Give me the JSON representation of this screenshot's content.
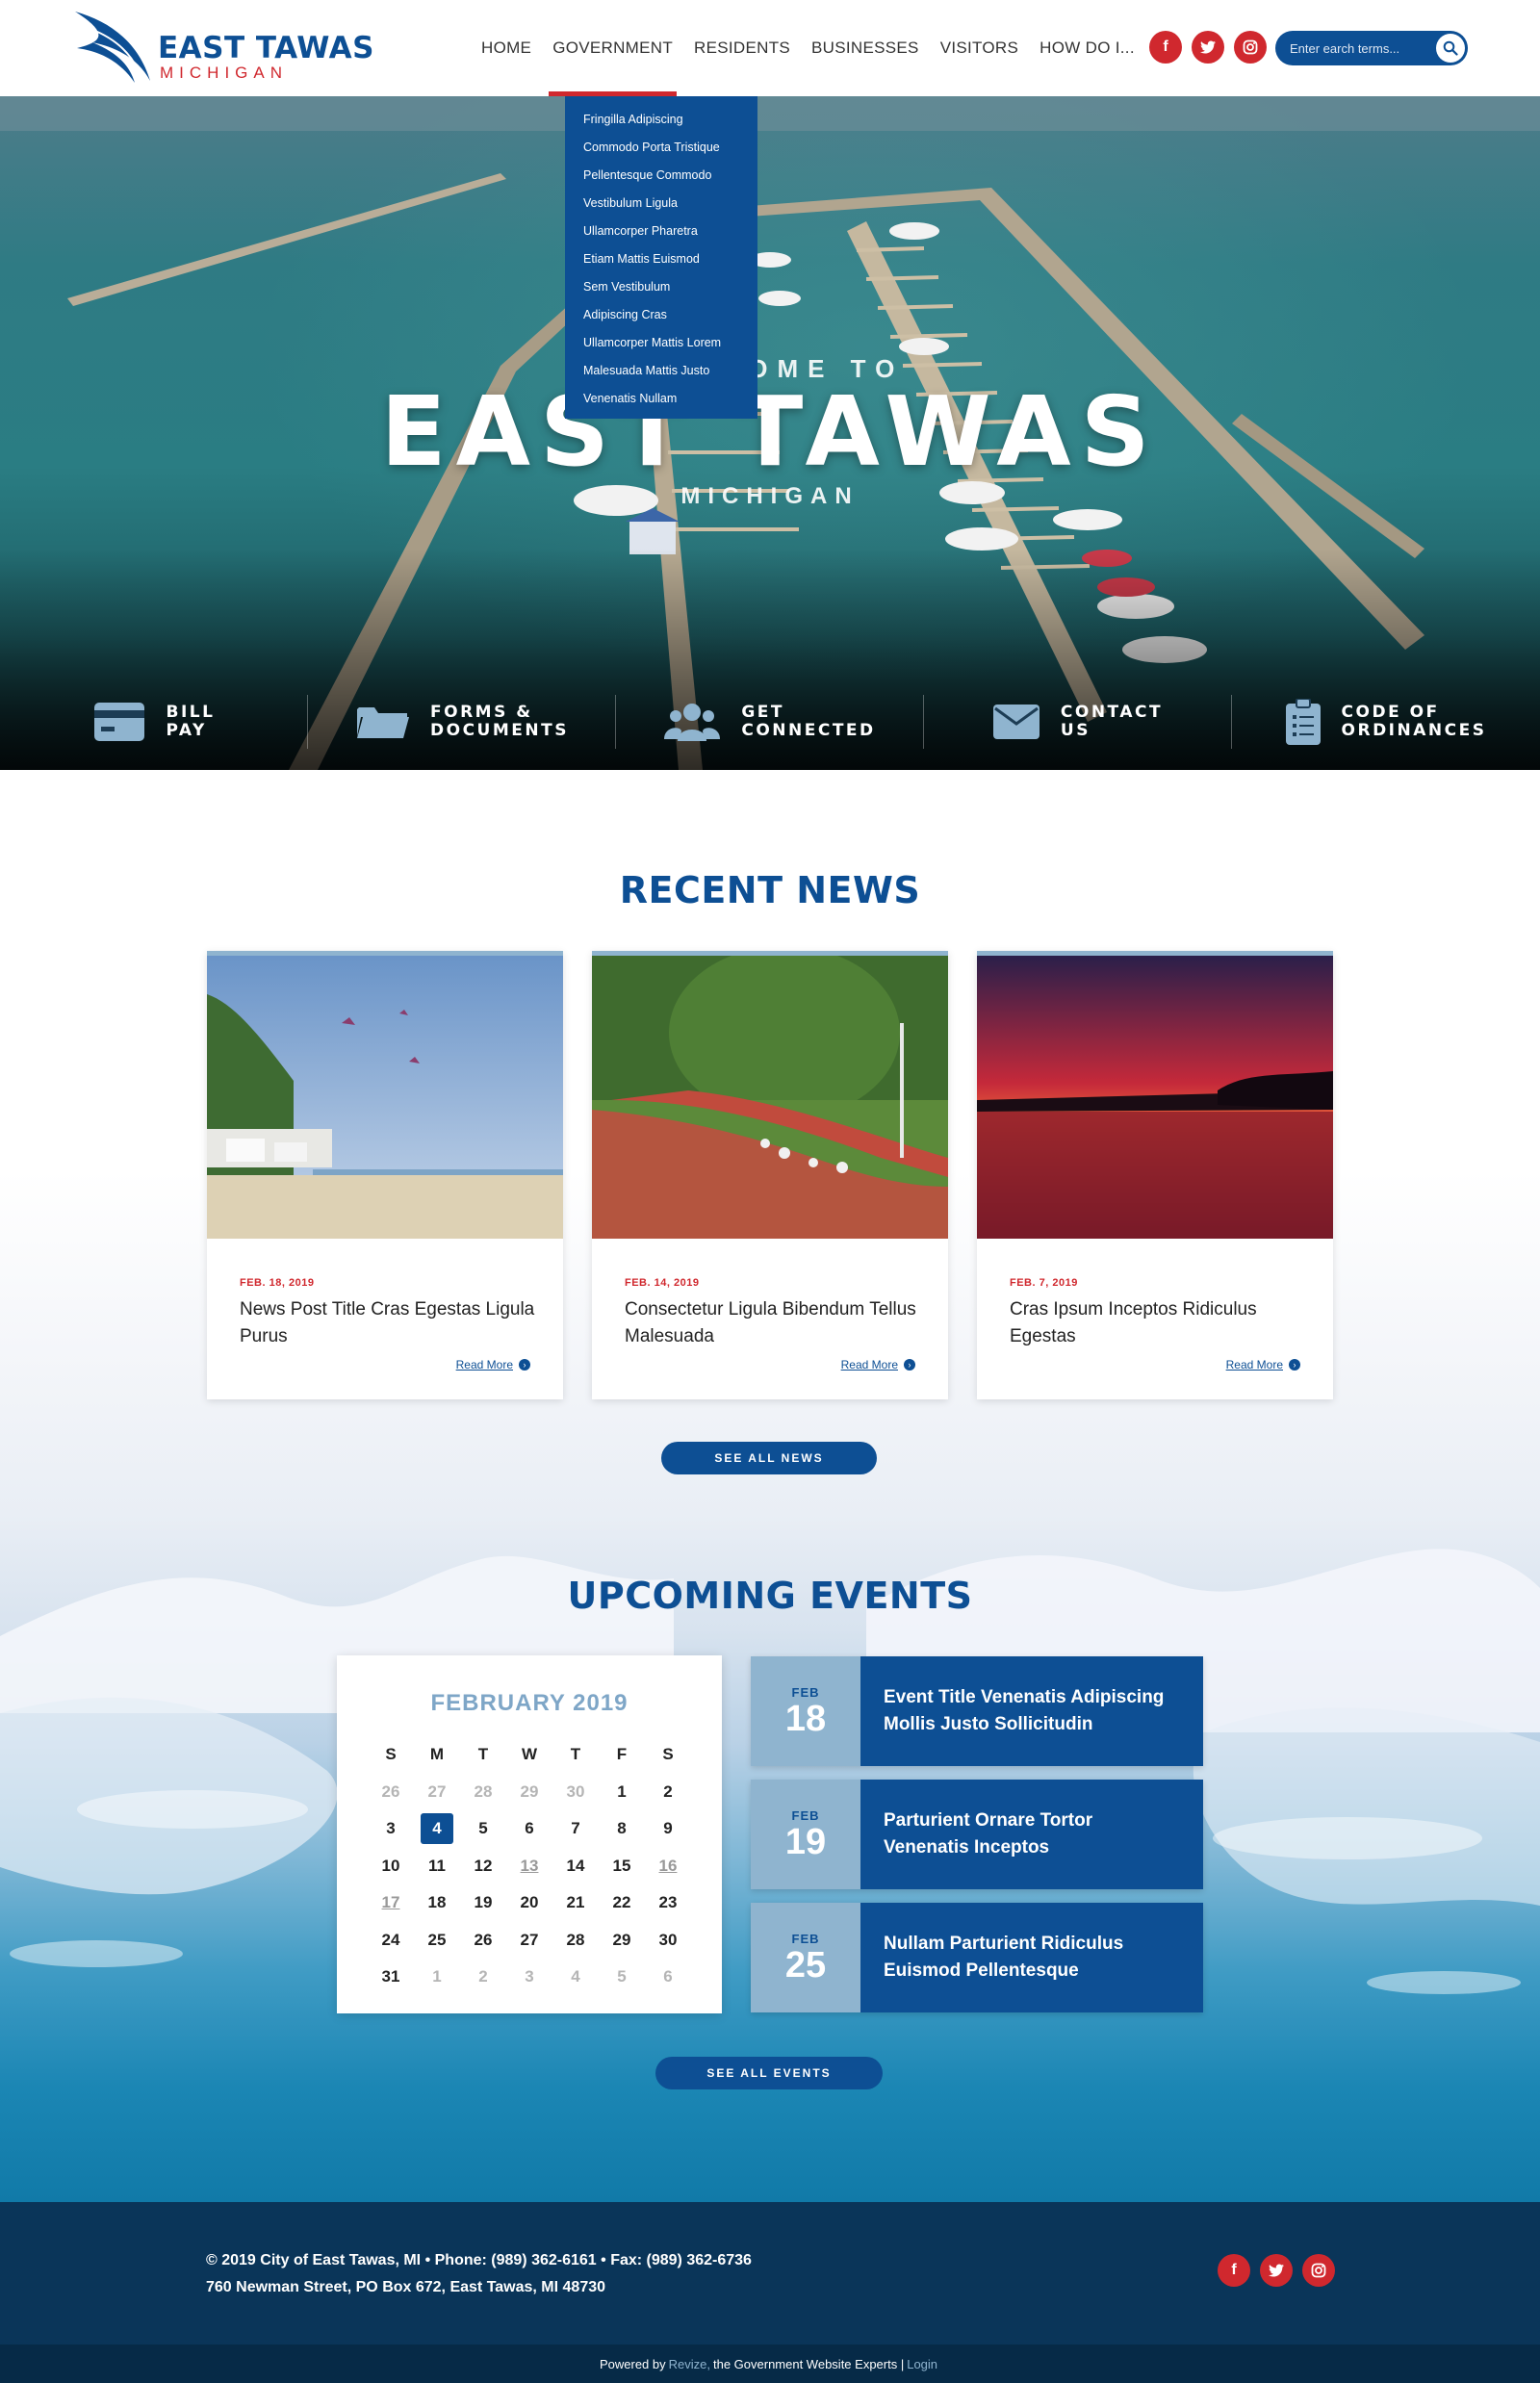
{
  "header": {
    "logo_title": "EAST TAWAS",
    "logo_subtitle": "MICHIGAN",
    "nav": [
      "HOME",
      "GOVERNMENT",
      "RESIDENTS",
      "BUSINESSES",
      "VISITORS",
      "HOW DO I..."
    ],
    "active_nav": "GOVERNMENT",
    "social": [
      "facebook-icon",
      "twitter-icon",
      "instagram-icon"
    ],
    "search_placeholder": "Enter earch terms..."
  },
  "dropdown": [
    "Fringilla Adipiscing",
    "Commodo Porta Tristique",
    "Pellentesque Commodo",
    "Vestibulum Ligula",
    "Ullamcorper Pharetra",
    "Etiam Mattis Euismod",
    "Sem Vestibulum",
    "Adipiscing Cras",
    "Ullamcorper Mattis Lorem",
    "Malesuada Mattis Justo",
    "Venenatis Nullam"
  ],
  "hero": {
    "welcome": "WELCOME TO",
    "title": "EAST TAWAS",
    "subtitle": "MICHIGAN",
    "quick_links": [
      {
        "icon": "credit-card-icon",
        "label": "BILL\nPAY"
      },
      {
        "icon": "folder-icon",
        "label": "FORMS &\nDOCUMENTS"
      },
      {
        "icon": "users-icon",
        "label": "GET\nCONNECTED"
      },
      {
        "icon": "envelope-icon",
        "label": "CONTACT\nUS"
      },
      {
        "icon": "clipboard-icon",
        "label": "CODE OF\nORDINANCES"
      }
    ]
  },
  "news": {
    "title": "RECENT NEWS",
    "read_more": "Read More",
    "items": [
      {
        "date": "FEB. 18, 2019",
        "title": "News Post Title Cras Egestas Ligula Purus"
      },
      {
        "date": "FEB. 14, 2019",
        "title": "Consectetur Ligula Bibendum Tellus Malesuada"
      },
      {
        "date": "FEB. 7, 2019",
        "title": "Cras Ipsum Inceptos Ridiculus Egestas"
      }
    ],
    "see_all": "SEE ALL NEWS"
  },
  "events": {
    "title": "UPCOMING EVENTS",
    "calendar": {
      "month": "FEBRUARY 2019",
      "weekdays": [
        "S",
        "M",
        "T",
        "W",
        "T",
        "F",
        "S"
      ],
      "days": [
        [
          "26",
          "27",
          "28",
          "29",
          "30",
          "1",
          "2"
        ],
        [
          "3",
          "4",
          "5",
          "6",
          "7",
          "8",
          "9"
        ],
        [
          "10",
          "11",
          "12",
          "13",
          "14",
          "15",
          "16"
        ],
        [
          "17",
          "18",
          "19",
          "20",
          "21",
          "22",
          "23"
        ],
        [
          "24",
          "25",
          "26",
          "27",
          "28",
          "29",
          "30"
        ],
        [
          "31",
          "1",
          "2",
          "3",
          "4",
          "5",
          "6"
        ]
      ],
      "today": "4",
      "event_days": [
        "13",
        "16",
        "17"
      ]
    },
    "items": [
      {
        "month": "FEB",
        "day": "18",
        "title": "Event Title Venenatis Adipiscing Mollis Justo Sollicitudin"
      },
      {
        "month": "FEB",
        "day": "19",
        "title": "Parturient Ornare Tortor Venenatis Inceptos"
      },
      {
        "month": "FEB",
        "day": "25",
        "title": "Nullam Parturient Ridiculus Euismod Pellentesque"
      }
    ],
    "see_all": "SEE ALL EVENTS"
  },
  "footer": {
    "line1": "© 2019 City of East Tawas, MI  •  Phone: (989) 362-6161  •  Fax: (989) 362-6736",
    "line2": "760 Newman Street, PO Box 672, East Tawas, MI 48730",
    "powered_prefix": "Powered by",
    "powered_brand": "Revize,",
    "powered_suffix": "the Government Website Experts  |",
    "login": "Login"
  },
  "colors": {
    "brand_blue": "#0d4f94",
    "brand_red": "#d0282e",
    "light_blue": "#8fb4cf",
    "footer": "#0a3559"
  }
}
